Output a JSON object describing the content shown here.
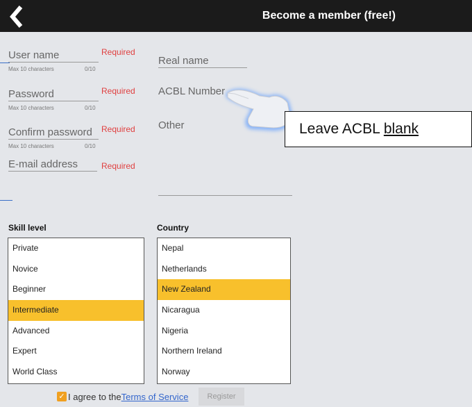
{
  "header": {
    "title": "Become a member (free!)",
    "back_icon": "chevron-left-icon"
  },
  "form": {
    "username": {
      "label": "User name",
      "required": "Required",
      "hint": "Max 10 characters",
      "count": "0/10"
    },
    "password": {
      "label": "Password",
      "required": "Required",
      "hint": "Max 10 characters",
      "count": "0/10"
    },
    "confirm_password": {
      "label": "Confirm password",
      "required": "Required",
      "hint": "Max 10 characters",
      "count": "0/10"
    },
    "email": {
      "label": "E-mail address",
      "required": "Required"
    },
    "real_name": {
      "label": "Real name"
    },
    "acbl_number": {
      "label": "ACBL Number"
    },
    "other": {
      "label": "Other"
    }
  },
  "callout": {
    "prefix": "Leave ACBL ",
    "emphasis": "blank"
  },
  "skill": {
    "label": "Skill level",
    "options": [
      "Private",
      "Novice",
      "Beginner",
      "Intermediate",
      "Advanced",
      "Expert",
      "World Class"
    ],
    "selected": "Intermediate"
  },
  "country": {
    "label": "Country",
    "options": [
      "Nepal",
      "Netherlands",
      "New Zealand",
      "Nicaragua",
      "Nigeria",
      "Northern Ireland",
      "Norway"
    ],
    "selected": "New Zealand"
  },
  "footer": {
    "agree_text": "I agree to the",
    "tos_link": "Terms of Service",
    "register_label": "Register",
    "checked": true
  },
  "colors": {
    "topbar": "#1b1b1b",
    "selection": "#f8c02c",
    "required": "#e04040",
    "link": "#3366cc"
  }
}
